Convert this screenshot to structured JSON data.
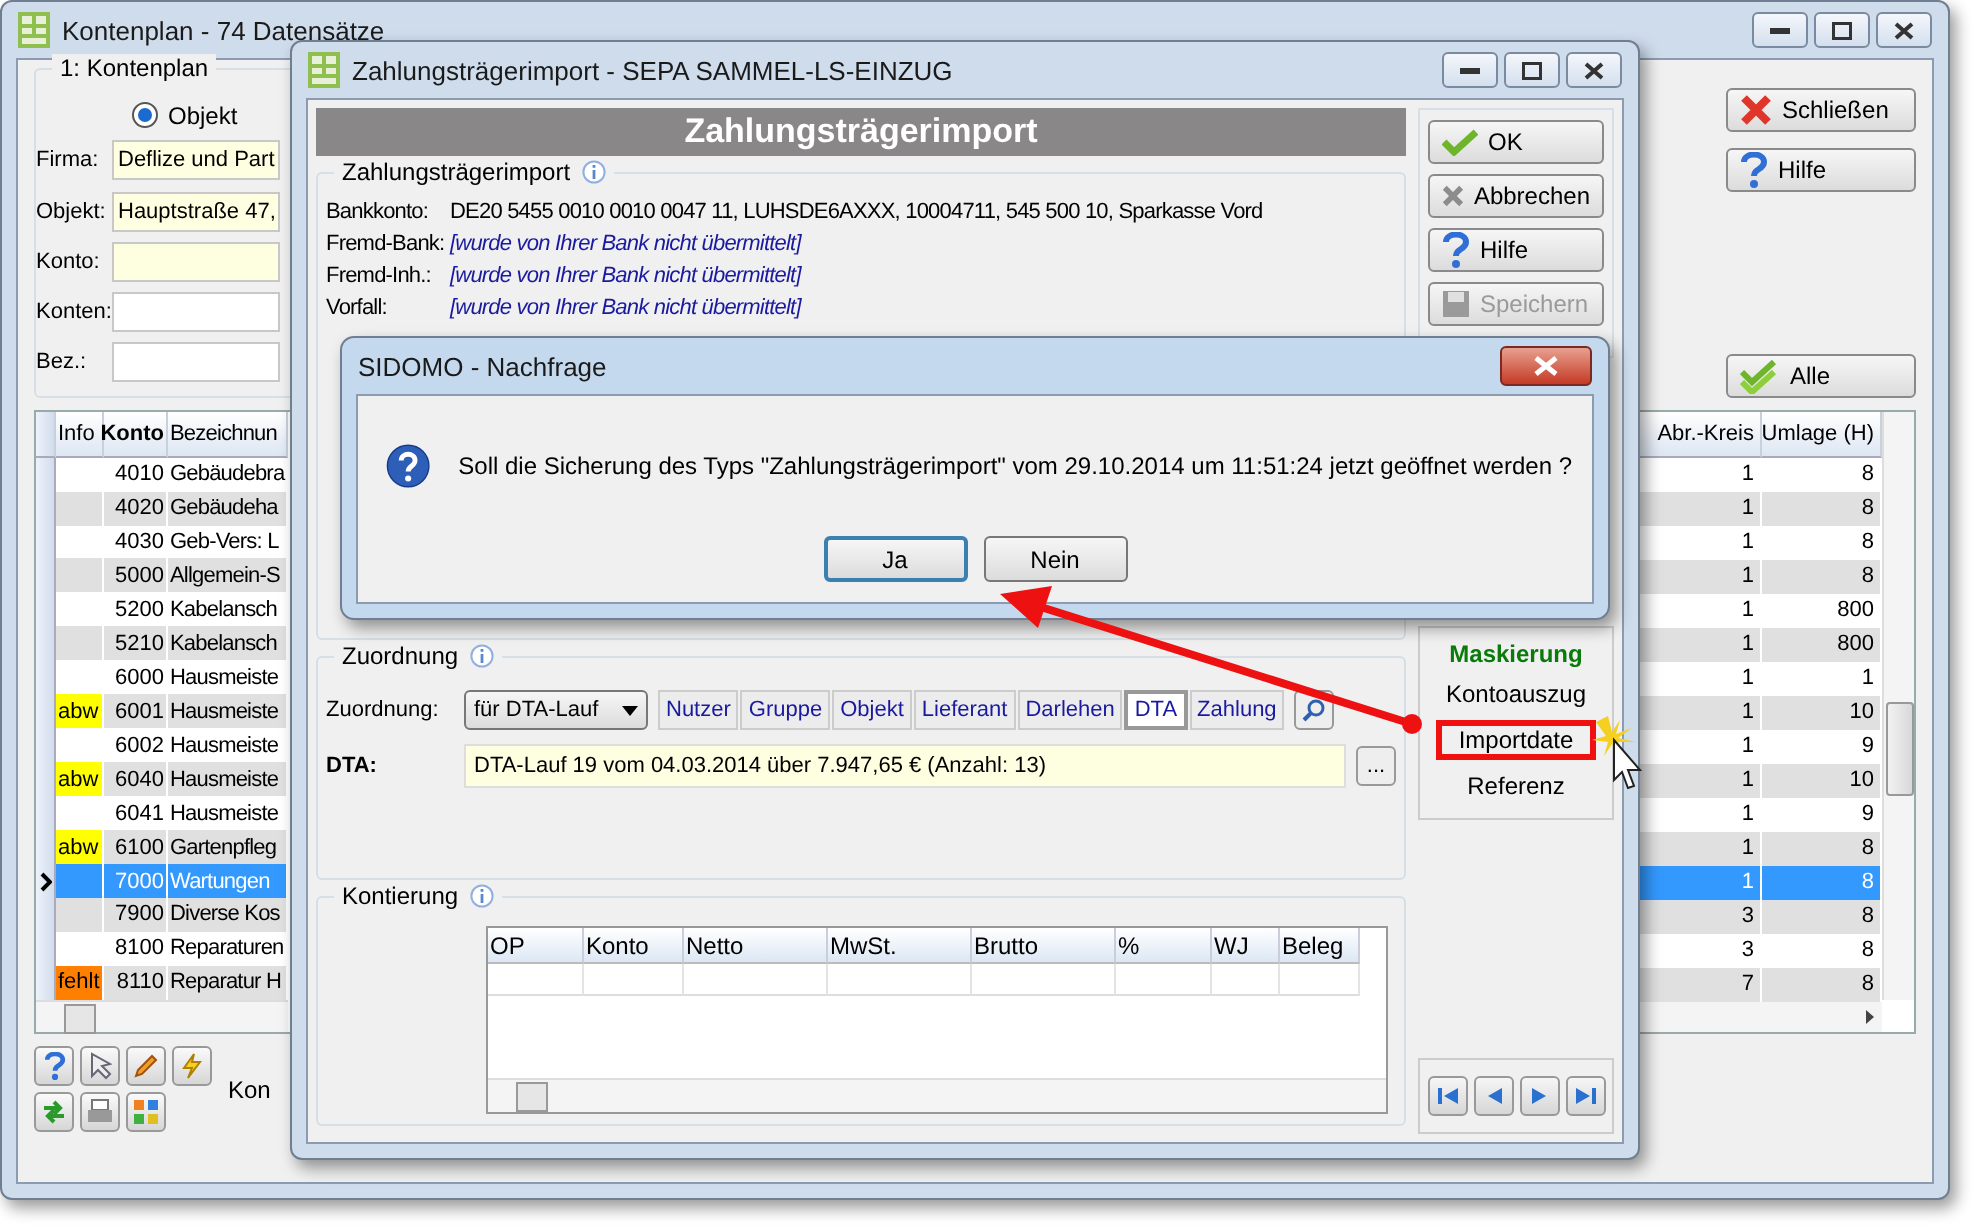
{
  "main_window": {
    "title": "Kontenplan - 74 Datensätze",
    "group_title": "1: Kontenplan",
    "radio_options": [
      {
        "label": "Objekt",
        "selected": true
      }
    ],
    "fields": [
      {
        "label": "Firma:",
        "value": "Deflize und Part",
        "highlighted": true
      },
      {
        "label": "Objekt:",
        "value": "Hauptstraße 47,",
        "highlighted": true
      },
      {
        "label": "Konto:",
        "highlighted": true
      },
      {
        "label": "Konten:",
        "highlighted": false
      },
      {
        "label": "Bez.:",
        "highlighted": false
      }
    ],
    "buttons": [
      {
        "label": "Schließen",
        "kind": "close"
      },
      {
        "label": "Hilfe",
        "kind": "help"
      },
      {
        "label": "Alle",
        "kind": "all"
      }
    ],
    "table": {
      "columns": [
        "Info",
        "Konto",
        "Bezeichnun",
        "Abr.-Kreis",
        "Umlage (H)"
      ],
      "rows": [
        {
          "konto": "4010",
          "name": "Gebäudebra",
          "kreis": "1",
          "umlage": "8",
          "selected": false
        },
        {
          "konto": "4020",
          "name": "Gebäudeha",
          "kreis": "1",
          "umlage": "8",
          "selected": false
        },
        {
          "konto": "4030",
          "name": "Geb-Vers: L",
          "kreis": "1",
          "umlage": "8",
          "selected": false
        },
        {
          "konto": "5000",
          "name": "Allgemein-S",
          "kreis": "1",
          "umlage": "8",
          "selected": false
        },
        {
          "konto": "5200",
          "name": "Kabelansch",
          "kreis": "1",
          "umlage": "800",
          "selected": false
        },
        {
          "konto": "5210",
          "name": "Kabelansch",
          "kreis": "1",
          "umlage": "800",
          "selected": false
        },
        {
          "konto": "6000",
          "name": "Hausmeiste",
          "kreis": "1",
          "umlage": "1",
          "selected": false
        },
        {
          "info": "abw",
          "color": "#ffff00",
          "konto": "6001",
          "name": "Hausmeiste",
          "kreis": "1",
          "umlage": "10",
          "selected": false
        },
        {
          "konto": "6002",
          "name": "Hausmeiste",
          "kreis": "1",
          "umlage": "9",
          "selected": false
        },
        {
          "info": "abw",
          "color": "#ffff00",
          "konto": "6040",
          "name": "Hausmeiste",
          "kreis": "1",
          "umlage": "10",
          "selected": false
        },
        {
          "konto": "6041",
          "name": "Hausmeiste",
          "kreis": "1",
          "umlage": "9",
          "selected": false
        },
        {
          "info": "abw",
          "color": "#ffff00",
          "konto": "6100",
          "name": "Gartenpfleg",
          "kreis": "1",
          "umlage": "8",
          "selected": false
        },
        {
          "konto": "7000",
          "name": "Wartungen",
          "kreis": "1",
          "umlage": "8",
          "selected": true
        },
        {
          "konto": "7900",
          "name": "Diverse Kos",
          "kreis": "3",
          "umlage": "8",
          "selected": false
        },
        {
          "konto": "8100",
          "name": "Reparaturen",
          "kreis": "3",
          "umlage": "8",
          "selected": false
        },
        {
          "info": "fehlt",
          "color": "#ff8000",
          "konto": "8110",
          "name": "Reparatur H",
          "kreis": "7",
          "umlage": "8",
          "selected": false
        }
      ]
    },
    "status_text": "Kon"
  },
  "import_window": {
    "title": "Zahlungsträgerimport - SEPA SAMMEL-LS-EINZUG",
    "header": "Zahlungsträgerimport",
    "bank_group": {
      "title": "Zahlungsträgerimport",
      "rows": [
        {
          "label": "Bankkonto:",
          "value": "DE20 5455 0010 0010 0047 11,  LUHSDE6AXXX,  10004711,  545 500 10,  Sparkasse Vord",
          "kind": "plain"
        },
        {
          "label": "Fremd-Bank:",
          "value": "[wurde von Ihrer Bank nicht übermittelt]",
          "kind": "note"
        },
        {
          "label": "Fremd-Inh.:",
          "value": "[wurde von Ihrer Bank nicht übermittelt]",
          "kind": "note"
        },
        {
          "label": "Vorfall:",
          "value": "[wurde von Ihrer Bank nicht übermittelt]",
          "kind": "note"
        }
      ]
    },
    "assignment_group": {
      "title": "Zuordnung",
      "label": "Zuordnung:",
      "dropdown": "für DTA-Lauf",
      "tabs": [
        {
          "label": "Nutzer",
          "selected": false
        },
        {
          "label": "Gruppe",
          "selected": false
        },
        {
          "label": "Objekt",
          "selected": false
        },
        {
          "label": "Lieferant",
          "selected": false
        },
        {
          "label": "Darlehen",
          "selected": false
        },
        {
          "label": "DTA",
          "selected": true
        },
        {
          "label": "Zahlung",
          "selected": false
        }
      ],
      "dta_label": "DTA:",
      "dta_value": "DTA-Lauf 19 vom 04.03.2014 über 7.947,65 € (Anzahl: 13)",
      "browse_button": "..."
    },
    "posting_group": {
      "title": "Kontierung",
      "columns": [
        "OP",
        "Konto",
        "Netto",
        "MwSt.",
        "Brutto",
        "%",
        "WJ",
        "Beleg"
      ]
    },
    "buttons": [
      {
        "label": "OK",
        "kind": "ok",
        "disabled": false
      },
      {
        "label": "Abbrechen",
        "kind": "cancel",
        "disabled": false
      },
      {
        "label": "Hilfe",
        "kind": "help",
        "disabled": false
      },
      {
        "label": "Speichern",
        "kind": "save",
        "disabled": true
      }
    ],
    "masking": {
      "title": "Maskierung",
      "items": [
        {
          "label": "Kontoauszug",
          "highlighted": false
        },
        {
          "label": "Importdate",
          "highlighted": true
        },
        {
          "label": "Referenz",
          "highlighted": false
        }
      ]
    }
  },
  "dialog": {
    "title": "SIDOMO - Nachfrage",
    "message": "Soll die Sicherung des Typs \"Zahlungsträgerimport\" vom 29.10.2014 um 11:51:24 jetzt geöffnet werden ?",
    "buttons": [
      {
        "label": "Ja",
        "default": true
      },
      {
        "label": "Nein",
        "default": false
      }
    ]
  }
}
